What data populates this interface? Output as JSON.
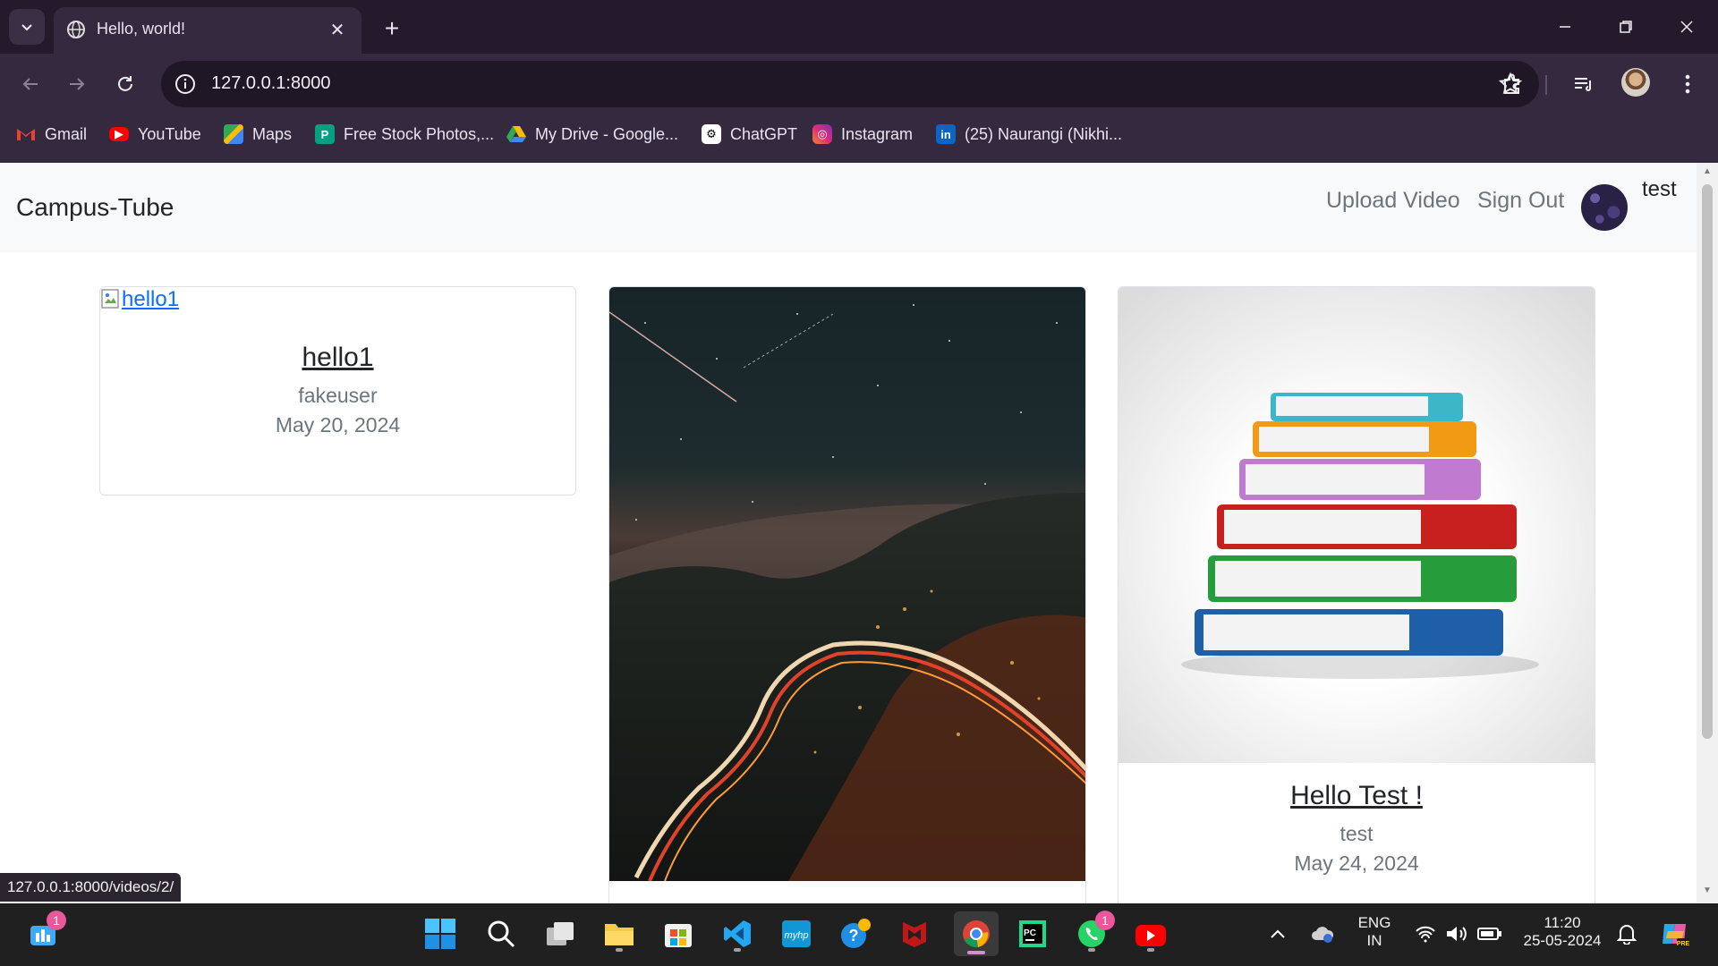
{
  "browser": {
    "tab_title": "Hello, world!",
    "new_tab_symbol": "+",
    "close_symbol": "✕",
    "url": "127.0.0.1:8000",
    "bookmarks": [
      {
        "label": "Gmail",
        "icon": "gmail-icon"
      },
      {
        "label": "YouTube",
        "icon": "youtube-icon"
      },
      {
        "label": "Maps",
        "icon": "maps-icon"
      },
      {
        "label": "Free Stock Photos,...",
        "icon": "stock-photos-icon"
      },
      {
        "label": "My Drive - Google...",
        "icon": "google-drive-icon"
      },
      {
        "label": "ChatGPT",
        "icon": "chatgpt-icon"
      },
      {
        "label": "Instagram",
        "icon": "instagram-icon"
      },
      {
        "label": "(25) Naurangi (Nikhi...",
        "icon": "linkedin-icon"
      }
    ],
    "status_url": "127.0.0.1:8000/videos/2/"
  },
  "site": {
    "brand": "Campus-Tube",
    "nav": {
      "upload": "Upload Video",
      "signout": "Sign Out"
    },
    "user": {
      "name": "test"
    }
  },
  "videos": [
    {
      "title": "hello1",
      "thumbnail_alt": "hello1",
      "author": "fakeuser",
      "date": "May 20, 2024",
      "thumbnail": "broken-image"
    },
    {
      "title": "",
      "author": "",
      "date": "",
      "thumbnail": "night-mountain-road-light-trails"
    },
    {
      "title": "Hello Test !",
      "author": "test",
      "date": "May 24, 2024",
      "thumbnail": "stack-of-books"
    }
  ],
  "taskbar": {
    "widgets_badge": "1",
    "whatsapp_badge": "1",
    "language": {
      "line1": "ENG",
      "line2": "IN"
    },
    "clock": {
      "time": "11:20",
      "date": "25-05-2024"
    }
  }
}
